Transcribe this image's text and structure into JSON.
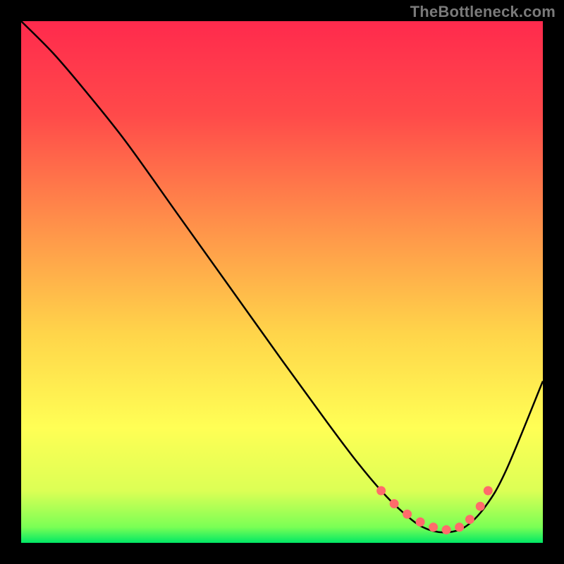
{
  "watermark": "TheBottleneck.com",
  "chart_data": {
    "type": "line",
    "title": "",
    "xlabel": "",
    "ylabel": "",
    "xlim": [
      0,
      100
    ],
    "ylim": [
      0,
      100
    ],
    "gradient_stops": [
      {
        "offset": 0,
        "color": "#ff2a4d"
      },
      {
        "offset": 18,
        "color": "#ff4a4a"
      },
      {
        "offset": 40,
        "color": "#ff944a"
      },
      {
        "offset": 60,
        "color": "#ffd54a"
      },
      {
        "offset": 78,
        "color": "#ffff55"
      },
      {
        "offset": 90,
        "color": "#dcff55"
      },
      {
        "offset": 97,
        "color": "#7aff55"
      },
      {
        "offset": 100,
        "color": "#00e865"
      }
    ],
    "series": [
      {
        "name": "bottleneck-curve",
        "color": "#000000",
        "x": [
          0,
          6,
          12,
          20,
          30,
          40,
          50,
          58,
          64,
          69,
          73,
          77,
          81,
          85,
          89,
          93,
          100
        ],
        "y": [
          100,
          94,
          87,
          77,
          63,
          49,
          35,
          24,
          16,
          10,
          6,
          3,
          2,
          3,
          7,
          14,
          31
        ]
      }
    ],
    "markers": {
      "name": "optimal-range",
      "color": "#ff6b6b",
      "x": [
        69,
        71.5,
        74,
        76.5,
        79,
        81.5,
        84,
        86,
        88,
        89.5
      ],
      "y": [
        10,
        7.5,
        5.5,
        4,
        3,
        2.5,
        3,
        4.5,
        7,
        10
      ]
    }
  }
}
